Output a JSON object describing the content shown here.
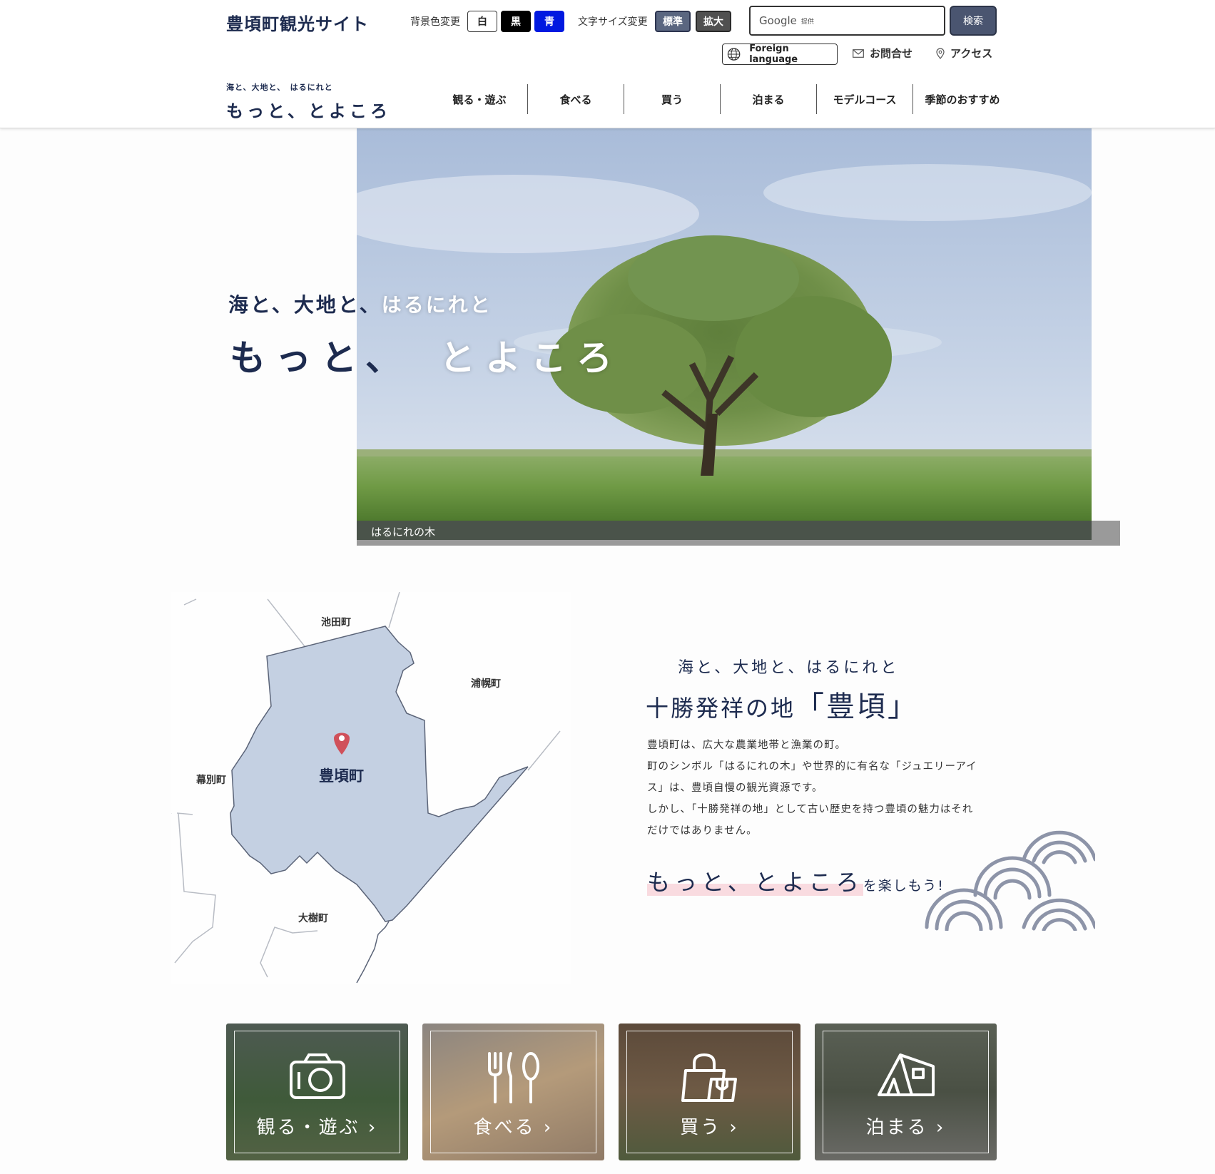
{
  "header": {
    "site_title": "豊頃町観光サイト",
    "bg_label": "背景色変更",
    "bg_white": "白",
    "bg_black": "黒",
    "bg_blue": "青",
    "size_label": "文字サイズ変更",
    "size_standard": "標準",
    "size_large": "拡大",
    "search_google": "Google",
    "search_provided": "提供",
    "search_button": "検索",
    "foreign_language": "Foreign language",
    "contact": "お問合せ",
    "access": "アクセス",
    "tagline_small": "海と、大地と、　はるにれと",
    "tagline_big": "もっと、とよころ"
  },
  "nav": [
    "観る・遊ぶ",
    "食べる",
    "買う",
    "泊まる",
    "モデルコース",
    "季節のおすすめ"
  ],
  "hero": {
    "sub_dark": "海と、大地と、",
    "sub_light": "はるにれと",
    "main_dark": "もっと、",
    "main_light": "とよころ",
    "caption": "はるにれの木"
  },
  "map": {
    "labels": {
      "ikeda": "池田町",
      "urahoro": "浦幌町",
      "makubetsu": "幕別町",
      "toyokoro": "豊頃町",
      "taiki": "大樹町"
    }
  },
  "intro": {
    "sub": "海と、大地と、はるにれと",
    "title_pre": "十勝発祥の地",
    "title_name": "「豊頃」",
    "body": [
      "豊頃町は、広大な農業地帯と漁業の町。",
      "町のシンボル「はるにれの木」や世界的に有名な「ジュエリーアイ",
      "ス」は、豊頃自慢の観光資源です。",
      "しかし、「十勝発祥の地」として古い歴史を持つ豊頃の魅力はそれ",
      "だけではありません。"
    ],
    "fun_highlight": "もっと、とよころ",
    "fun_suffix": "を楽しもう!"
  },
  "tiles": [
    {
      "label": "観る・遊ぶ ›",
      "icon": "camera-icon"
    },
    {
      "label": "食べる ›",
      "icon": "cutlery-icon"
    },
    {
      "label": "買う ›",
      "icon": "shopping-bag-icon"
    },
    {
      "label": "泊まる ›",
      "icon": "tent-icon"
    }
  ],
  "colors": {
    "navy": "#1d2b4f",
    "map_fill": "#c4d0e2",
    "pin": "#d0505a",
    "highlight": "#f9dbe0"
  }
}
